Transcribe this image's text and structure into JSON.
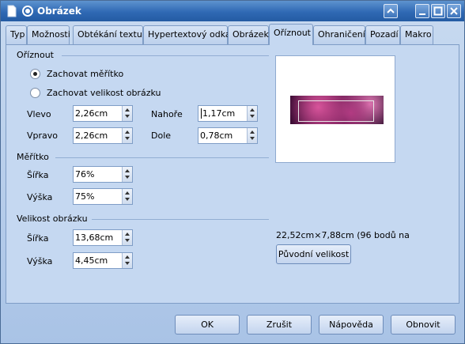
{
  "window": {
    "title": "Obrázek"
  },
  "tabs": [
    {
      "label": "Typ"
    },
    {
      "label": "Možnosti"
    },
    {
      "label": "Obtékání textu"
    },
    {
      "label": "Hypertextový odkaz"
    },
    {
      "label": "Obrázek"
    },
    {
      "label": "Oříznout"
    },
    {
      "label": "Ohraničení"
    },
    {
      "label": "Pozadí"
    },
    {
      "label": "Makro"
    }
  ],
  "active_tab": "Oříznout",
  "crop": {
    "section_title": "Oříznout",
    "keep_scale_label": "Zachovat měřítko",
    "keep_size_label": "Zachovat velikost obrázku",
    "keep_scale_checked": true,
    "left_label": "Vlevo",
    "left_value": "2,26cm",
    "right_label": "Vpravo",
    "right_value": "2,26cm",
    "top_label": "Nahoře",
    "top_value": "1,17cm",
    "bottom_label": "Dole",
    "bottom_value": "0,78cm"
  },
  "scale": {
    "section_title": "Měřítko",
    "width_label": "Šířka",
    "width_value": "76%",
    "height_label": "Výška",
    "height_value": "75%"
  },
  "image_size": {
    "section_title": "Velikost obrázku",
    "width_label": "Šířka",
    "width_value": "13,68cm",
    "height_label": "Výška",
    "height_value": "4,45cm"
  },
  "preview": {
    "info_text": "22,52cm×7,88cm (96 bodů na",
    "original_size_button": "Původní velikost"
  },
  "footer": {
    "ok": "OK",
    "cancel": "Zrušit",
    "help": "Nápověda",
    "reset": "Obnovit"
  }
}
